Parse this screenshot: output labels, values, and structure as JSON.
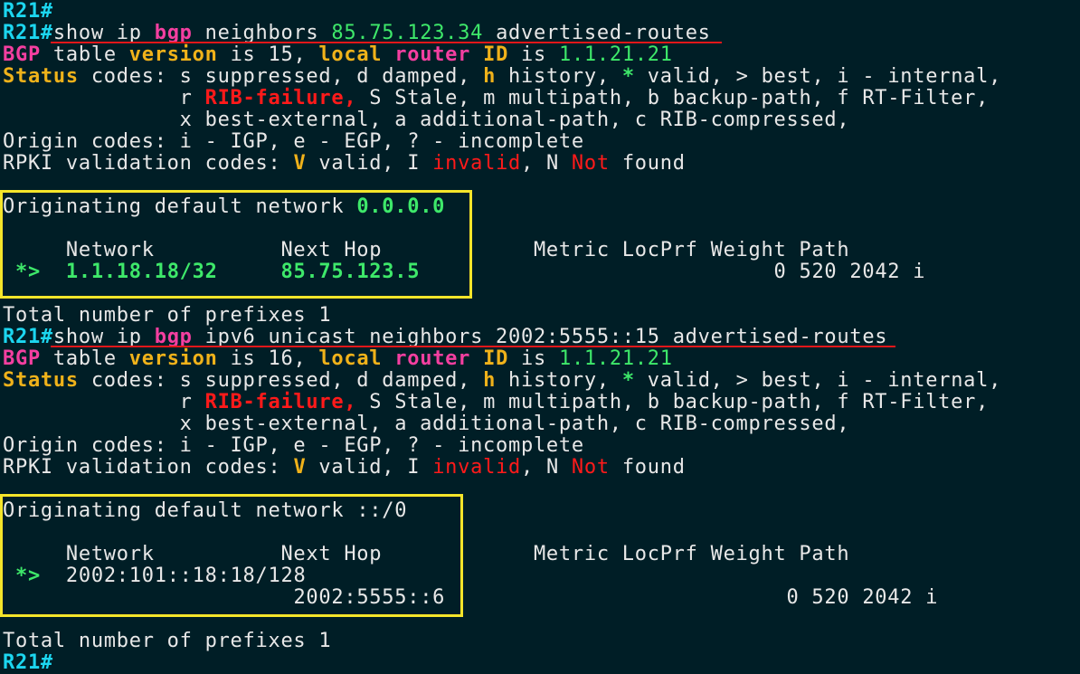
{
  "prompt": "R21#",
  "block1": {
    "cmd": "show ip bgp neighbors 85.75.123.34 advertised-routes",
    "cmd_parts": [
      "show ip ",
      "bgp",
      " neighbors ",
      "85.75.123.34",
      " advertised-routes"
    ],
    "table_pre": "BGP",
    "table_mid1": " table ",
    "version_kw": "version",
    "table_mid2": " is 15, ",
    "local_kw": "local",
    "router_kw": "router",
    "id_kw": "ID",
    "is_kw": " is ",
    "router_id": "1.1.21.21",
    "status_kw": "Status",
    "status_a": " codes: s suppressed, d damped, ",
    "status_h": "h",
    "status_b": " history, ",
    "status_star": "*",
    "status_c": " valid, > best, i - internal,",
    "r_pre": "              r ",
    "rib_fail": "RIB-failure,",
    "r_post": " S Stale, m multipath, b backup-path, f RT-Filter,",
    "x_line": "              x best-external, a additional-path, c RIB-compressed,",
    "origin": "Origin codes: i - IGP, e - EGP, ? - incomplete",
    "rpki_pre": "RPKI validation codes: ",
    "rpki_v": "V",
    "rpki_valid": " valid, I ",
    "rpki_invalid": "invalid",
    "rpki_n": ", N ",
    "rpki_not": "Not",
    "rpki_found": " found",
    "orig_label": "Originating default network ",
    "orig_net": "0.0.0.0",
    "header": "     Network          Next Hop            Metric LocPrf Weight Path",
    "row_flag": " *>",
    "row_net": "1.1.18.18/32",
    "row_nh": "85.75.123.5",
    "row_tail": "0 520 2042 i",
    "total": "Total number of prefixes 1"
  },
  "block2": {
    "cmd_parts": [
      "show ip ",
      "bgp",
      " ipv6 unicast neighbors 2002:5555::15 advertised-routes"
    ],
    "table_mid2": " is 16, ",
    "orig_net": "::/0",
    "row_net": "2002:101::18:18/128",
    "row_nh": "2002:5555::6",
    "row_tail": "0 520 2042 i"
  }
}
